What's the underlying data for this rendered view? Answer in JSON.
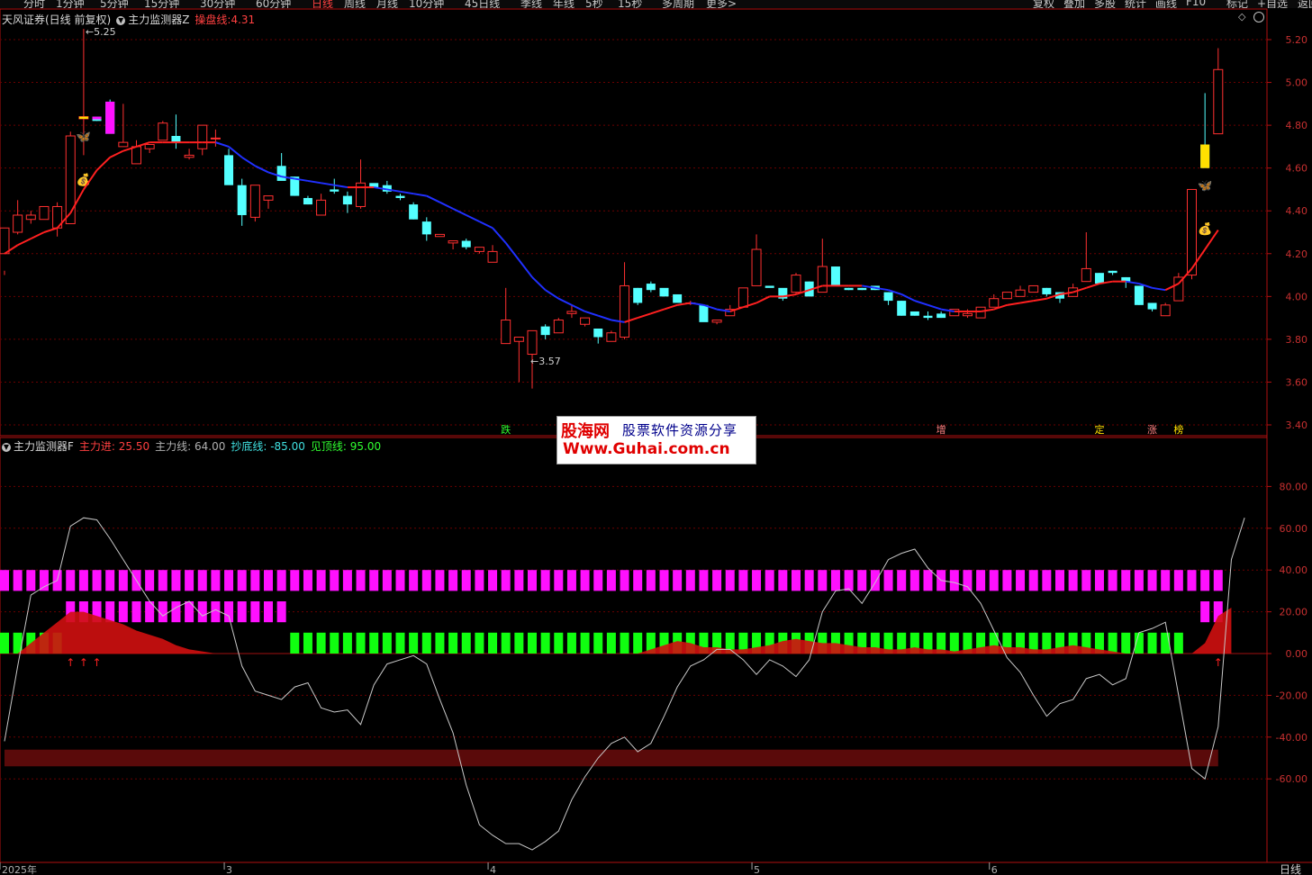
{
  "toolbar": {
    "periods": [
      "分时",
      "1分钟",
      "5分钟",
      "15分钟",
      "30分钟",
      "60分钟",
      "日线",
      "周线",
      "月线",
      "10分钟",
      "45日线",
      "季线",
      "年线",
      "5秒",
      "15秒",
      "多周期",
      "更多>"
    ],
    "active_period": "日线",
    "right_tools": [
      "复权",
      "叠加",
      "多股",
      "统计",
      "画线",
      "F10",
      "标记",
      "+自选",
      "返回"
    ]
  },
  "top_panel": {
    "stock": "天风证券(日线 前复权)",
    "indicator": "主力监测器Z",
    "metric_label": "操盘线:",
    "metric_value": "4.31"
  },
  "bottom_panel": {
    "indicator": "主力监测器F",
    "readings": [
      {
        "label": "主力进:",
        "value": "25.50",
        "color": "#ff4040"
      },
      {
        "label": "主力线:",
        "value": "64.00",
        "color": "#b0b0b0"
      },
      {
        "label": "抄底线:",
        "value": "-85.00",
        "color": "#40e0e0"
      },
      {
        "label": "见顶线:",
        "value": "95.00",
        "color": "#30ff30"
      }
    ]
  },
  "watermark": {
    "brand": "股海网",
    "slogan": "股票软件资源分享",
    "url": "Www.Guhai.com.cn"
  },
  "bottom_right_label": "日线",
  "colors": {
    "up": "#ff3030",
    "down": "#54ffff",
    "ma_up": "#ff2020",
    "ma_down": "#2030ff",
    "magenta": "#ff10ff",
    "green": "#10ff10",
    "grid": "#6a0000",
    "axis": "#b01010"
  },
  "chart_data": [
    {
      "type": "candlestick",
      "ylim": [
        3.35,
        5.28
      ],
      "yticks": [
        "5.20",
        "5.00",
        "4.80",
        "4.60",
        "4.40",
        "4.20",
        "4.00",
        "3.80",
        "3.60",
        "3.40"
      ],
      "xticks": [
        {
          "label": "2025年",
          "index": 0
        },
        {
          "label": "3",
          "index": 17
        },
        {
          "label": "4",
          "index": 37
        },
        {
          "label": "5",
          "index": 57
        },
        {
          "label": "6",
          "index": 75
        }
      ],
      "high_label": "5.25",
      "low_label": "3.57",
      "candles": [
        [
          4.2,
          4.32,
          4.12,
          4.1
        ],
        [
          4.3,
          4.38,
          4.29,
          4.45
        ],
        [
          4.36,
          4.38,
          4.34,
          4.4
        ],
        [
          4.36,
          4.42,
          4.36,
          4.36
        ],
        [
          4.32,
          4.42,
          4.28,
          4.44
        ],
        [
          4.34,
          4.75,
          4.34,
          4.77
        ],
        [
          4.83,
          4.84,
          4.66,
          5.25
        ],
        [
          4.84,
          4.82,
          4.83,
          4.82
        ],
        [
          4.91,
          4.76,
          4.92,
          4.83
        ],
        [
          4.7,
          4.72,
          4.7,
          4.9
        ],
        [
          4.62,
          4.7,
          4.67,
          4.73
        ],
        [
          4.69,
          4.71,
          4.67,
          4.71
        ],
        [
          4.73,
          4.81,
          4.74,
          4.82
        ],
        [
          4.75,
          4.72,
          4.69,
          4.85
        ],
        [
          4.65,
          4.66,
          4.64,
          4.69
        ],
        [
          4.69,
          4.8,
          4.66,
          4.8
        ],
        [
          4.74,
          4.74,
          4.7,
          4.78
        ],
        [
          4.66,
          4.52,
          4.69,
          4.53
        ],
        [
          4.52,
          4.38,
          4.55,
          4.33
        ],
        [
          4.37,
          4.52,
          4.35,
          4.51
        ],
        [
          4.45,
          4.47,
          4.41,
          4.47
        ],
        [
          4.61,
          4.54,
          4.6,
          4.67
        ],
        [
          4.56,
          4.47,
          4.56,
          4.47
        ],
        [
          4.46,
          4.43,
          4.47,
          4.43
        ],
        [
          4.38,
          4.45,
          4.38,
          4.48
        ],
        [
          4.5,
          4.49,
          4.48,
          4.55
        ],
        [
          4.47,
          4.43,
          4.49,
          4.39
        ],
        [
          4.42,
          4.53,
          4.41,
          4.64
        ],
        [
          4.53,
          4.51,
          4.53,
          4.53
        ],
        [
          4.52,
          4.49,
          4.54,
          4.48
        ],
        [
          4.47,
          4.46,
          4.48,
          4.45
        ],
        [
          4.43,
          4.36,
          4.44,
          4.36
        ],
        [
          4.35,
          4.29,
          4.37,
          4.26
        ],
        [
          4.28,
          4.29,
          4.28,
          4.29
        ],
        [
          4.25,
          4.26,
          4.25,
          4.22
        ],
        [
          4.26,
          4.23,
          4.27,
          4.22
        ],
        [
          4.21,
          4.23,
          4.2,
          4.23
        ],
        [
          4.16,
          4.21,
          4.16,
          4.24
        ],
        [
          3.78,
          3.89,
          3.79,
          4.04
        ],
        [
          3.79,
          3.81,
          3.8,
          3.6
        ],
        [
          3.73,
          3.84,
          3.74,
          3.57
        ],
        [
          3.86,
          3.82,
          3.87,
          3.8
        ],
        [
          3.83,
          3.89,
          3.83,
          3.9
        ],
        [
          3.92,
          3.93,
          3.9,
          3.96
        ],
        [
          3.87,
          3.9,
          3.88,
          3.86
        ],
        [
          3.85,
          3.81,
          3.85,
          3.78
        ],
        [
          3.79,
          3.83,
          3.79,
          3.84
        ],
        [
          3.81,
          4.05,
          3.8,
          4.16
        ],
        [
          4.04,
          3.97,
          4.04,
          3.96
        ],
        [
          4.06,
          4.03,
          4.07,
          4.02
        ],
        [
          4.04,
          4.0,
          4.02,
          4.0
        ],
        [
          4.01,
          3.97,
          4.0,
          3.98
        ],
        [
          3.97,
          3.97,
          3.96,
          3.98
        ],
        [
          3.96,
          3.88,
          3.96,
          3.89
        ],
        [
          3.88,
          3.89,
          3.88,
          3.87
        ],
        [
          3.91,
          3.94,
          3.91,
          3.96
        ],
        [
          3.95,
          4.04,
          3.95,
          4.04
        ],
        [
          4.05,
          4.22,
          4.05,
          4.29
        ],
        [
          4.05,
          4.04,
          4.05,
          4.05
        ],
        [
          4.04,
          3.99,
          4.01,
          3.98
        ],
        [
          4.02,
          4.1,
          4.01,
          4.11
        ],
        [
          4.07,
          4.0,
          4.07,
          4.0
        ],
        [
          4.02,
          4.14,
          4.02,
          4.27
        ],
        [
          4.14,
          4.05,
          4.14,
          4.06
        ],
        [
          4.04,
          4.03,
          4.04,
          4.03
        ],
        [
          4.04,
          4.03,
          4.04,
          4.03
        ],
        [
          4.05,
          4.03,
          4.05,
          4.03
        ],
        [
          4.02,
          3.98,
          4.02,
          3.96
        ],
        [
          3.98,
          3.91,
          3.98,
          3.91
        ],
        [
          3.93,
          3.91,
          3.93,
          3.91
        ],
        [
          3.91,
          3.9,
          3.93,
          3.89
        ],
        [
          3.92,
          3.9,
          3.93,
          3.9
        ],
        [
          3.91,
          3.94,
          3.91,
          3.93
        ],
        [
          3.91,
          3.92,
          3.9,
          3.94
        ],
        [
          3.9,
          3.95,
          3.9,
          3.95
        ],
        [
          3.95,
          3.99,
          3.95,
          4.01
        ],
        [
          3.99,
          4.02,
          3.99,
          4.02
        ],
        [
          4.0,
          4.03,
          4.0,
          4.05
        ],
        [
          4.02,
          4.05,
          4.03,
          4.04
        ],
        [
          4.04,
          4.01,
          4.04,
          4.0
        ],
        [
          4.02,
          3.99,
          4.02,
          3.97
        ],
        [
          4.0,
          4.04,
          4.0,
          4.06
        ],
        [
          4.07,
          4.13,
          4.07,
          4.3
        ],
        [
          4.11,
          4.06,
          4.11,
          4.1
        ],
        [
          4.12,
          4.11,
          4.12,
          4.1
        ],
        [
          4.09,
          4.07,
          4.09,
          4.04
        ],
        [
          4.05,
          3.96,
          4.05,
          3.96
        ],
        [
          3.97,
          3.94,
          3.97,
          3.93
        ],
        [
          3.91,
          3.96,
          3.91,
          3.97
        ],
        [
          3.98,
          4.09,
          3.98,
          4.11
        ],
        [
          4.1,
          4.5,
          4.08,
          4.5
        ],
        [
          4.71,
          4.6,
          4.71,
          4.95
        ],
        [
          4.76,
          5.06,
          4.76,
          5.16
        ]
      ],
      "ma": [
        4.2,
        4.24,
        4.27,
        4.3,
        4.32,
        4.39,
        4.5,
        4.59,
        4.65,
        4.68,
        4.7,
        4.72,
        4.72,
        4.72,
        4.72,
        4.72,
        4.72,
        4.7,
        4.65,
        4.61,
        4.58,
        4.56,
        4.55,
        4.54,
        4.53,
        4.52,
        4.51,
        4.51,
        4.51,
        4.5,
        4.49,
        4.48,
        4.47,
        4.44,
        4.41,
        4.38,
        4.35,
        4.32,
        4.25,
        4.17,
        4.09,
        4.03,
        3.99,
        3.96,
        3.93,
        3.91,
        3.89,
        3.88,
        3.9,
        3.92,
        3.94,
        3.96,
        3.97,
        3.96,
        3.94,
        3.93,
        3.95,
        3.97,
        4.0,
        4.0,
        4.01,
        4.03,
        4.05,
        4.05,
        4.05,
        4.05,
        4.04,
        4.03,
        4.01,
        3.98,
        3.96,
        3.94,
        3.93,
        3.93,
        3.93,
        3.94,
        3.96,
        3.97,
        3.98,
        3.99,
        4.01,
        4.02,
        4.04,
        4.06,
        4.07,
        4.07,
        4.06,
        4.04,
        4.03,
        4.06,
        4.13,
        4.22,
        4.31
      ],
      "tops": [
        6,
        91
      ],
      "bottom_signals": [
        {
          "index": 38,
          "label": "跌"
        },
        {
          "index": 71,
          "label": "增"
        },
        {
          "index": 83,
          "label": "定"
        },
        {
          "index": 87,
          "label": "涨"
        },
        {
          "index": 89,
          "label": "榜"
        }
      ]
    },
    {
      "type": "oscillator",
      "ylim": [
        -97,
        101
      ],
      "yticks": [
        "80.00",
        "60.00",
        "40.00",
        "20.00",
        "0.00",
        "-20.00",
        "-40.00",
        "-60.00"
      ],
      "main_line": [
        -42,
        -6,
        28,
        32,
        35,
        61,
        65,
        64,
        55,
        45,
        35,
        25,
        18,
        22,
        25,
        18,
        21,
        18,
        -6,
        -18,
        -20,
        -22,
        -16,
        -14,
        -26,
        -28,
        -27,
        -34,
        -15,
        -5,
        -3,
        -1,
        -5,
        -22,
        -38,
        -63,
        -82,
        -87,
        -91,
        -91,
        -94,
        -90,
        -85,
        -70,
        -59,
        -50,
        -43,
        -40,
        -47,
        -43,
        -30,
        -16,
        -6,
        -3,
        2,
        2,
        -3,
        -10,
        -3,
        -6,
        -11,
        -3,
        20,
        30,
        31,
        24,
        34,
        45,
        48,
        50,
        41,
        35,
        34,
        32,
        24,
        11,
        -2,
        -9,
        -20,
        -30,
        -24,
        -22,
        -12,
        -10,
        -15,
        -12,
        10,
        12,
        15,
        -20,
        -55,
        -60,
        -35,
        45,
        65
      ],
      "red_area": [
        0,
        0,
        5,
        10,
        15,
        20,
        20,
        18,
        16,
        14,
        11,
        9,
        7,
        4,
        2,
        1,
        0,
        0,
        0,
        0,
        0,
        0,
        0,
        0,
        0,
        0,
        0,
        0,
        0,
        0,
        0,
        0,
        0,
        0,
        0,
        0,
        0,
        0,
        0,
        0,
        0,
        0,
        0,
        0,
        0,
        0,
        0,
        0,
        0,
        2,
        4,
        6,
        5,
        3,
        3,
        2,
        2,
        3,
        4,
        6,
        7,
        6,
        5,
        5,
        4,
        3,
        3,
        2,
        2,
        3,
        2,
        2,
        1,
        2,
        3,
        4,
        3,
        3,
        2,
        2,
        3,
        4,
        3,
        2,
        1,
        0,
        0,
        0,
        0,
        0,
        0,
        5,
        18,
        22
      ],
      "magenta_upper": {
        "from": 0,
        "to": 92,
        "range": [
          30,
          40
        ]
      },
      "magenta_lower": [
        {
          "from": 5,
          "to": 21,
          "range": [
            15,
            25
          ]
        },
        {
          "from": 91,
          "to": 92,
          "range": [
            15,
            25
          ]
        }
      ],
      "green_bars": [
        {
          "from": 0,
          "to": 4,
          "range": [
            0,
            10
          ]
        },
        {
          "from": 22,
          "to": 89,
          "range": [
            0,
            10
          ]
        }
      ],
      "dark_band": {
        "center": -50,
        "half_width": 4
      },
      "arrow_indices": [
        5,
        6,
        7,
        92
      ]
    }
  ]
}
